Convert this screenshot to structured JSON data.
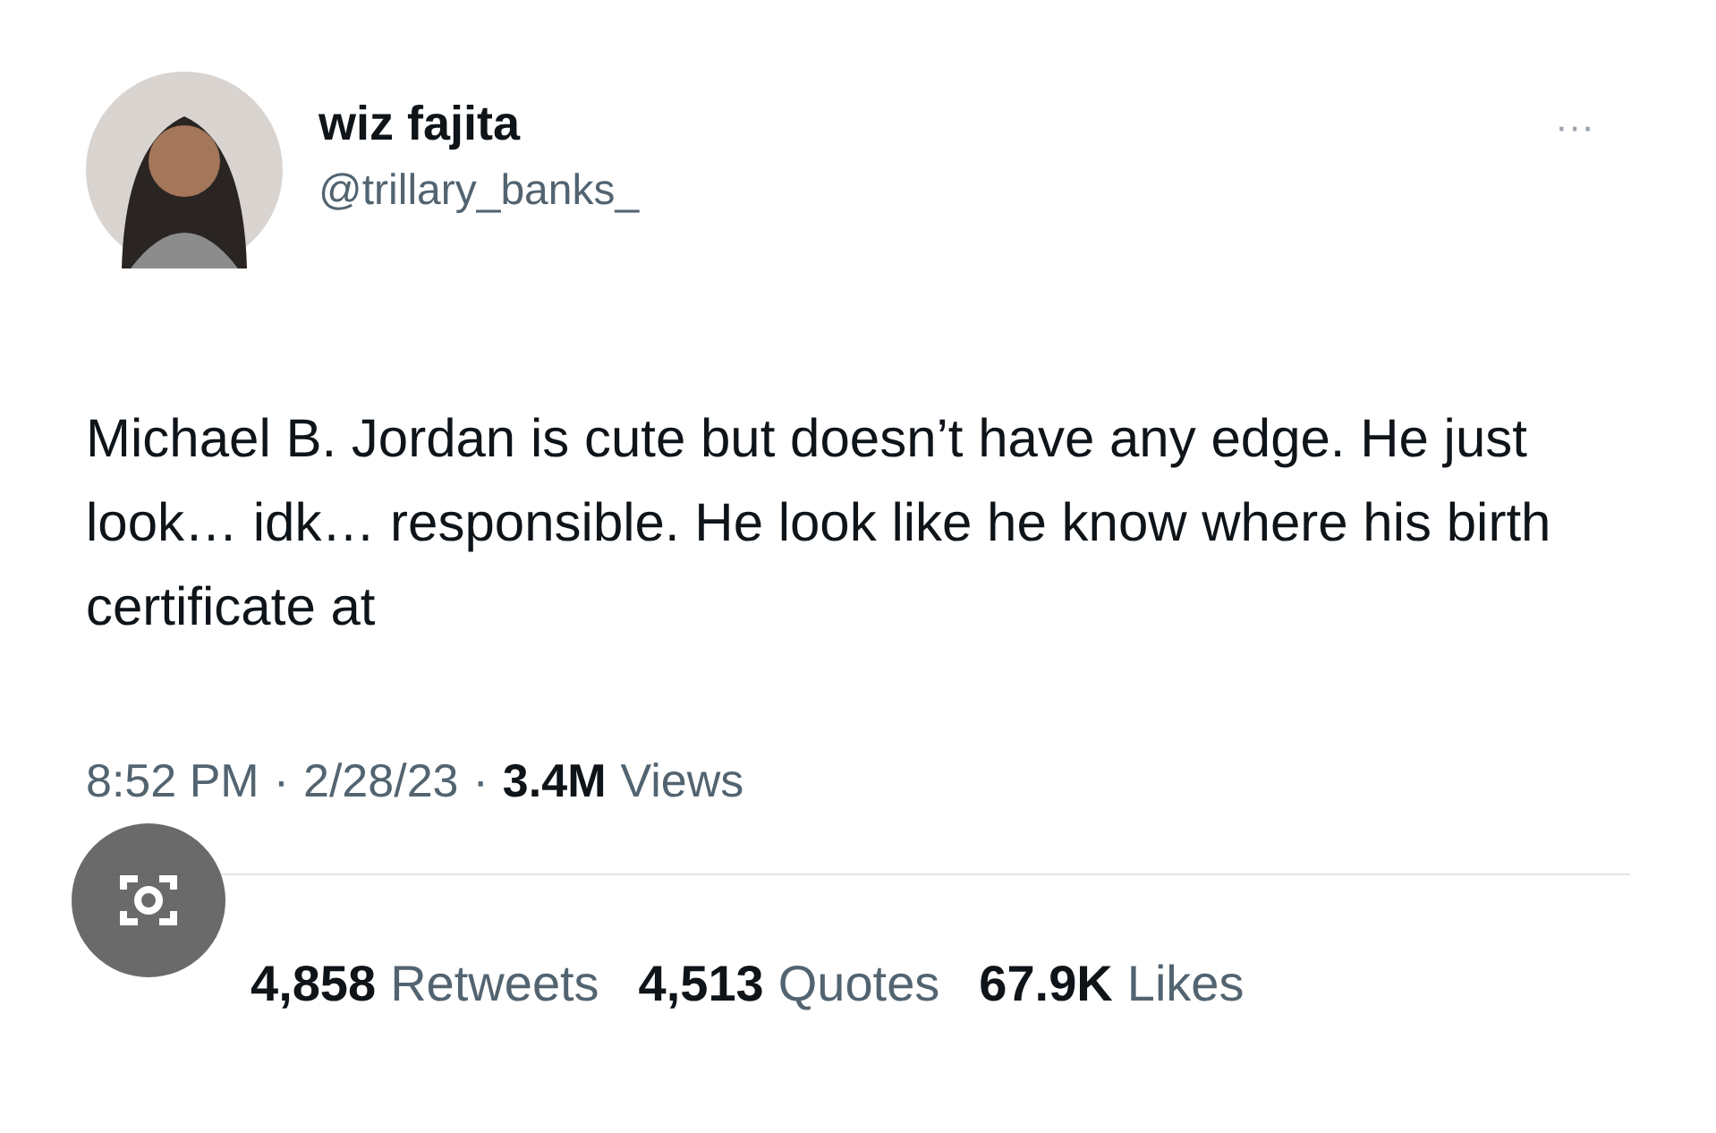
{
  "author": {
    "name": "wiz fajita",
    "handle": "@trillary_banks_"
  },
  "more_button": "···",
  "text": "Michael B. Jordan is cute but doesn’t have any edge. He just look… idk… responsible. He look like he know where his birth certificate at",
  "meta": {
    "time": "8:52 PM",
    "separator": "·",
    "date": "2/28/23",
    "views_count": "3.4M",
    "views_label": "Views"
  },
  "stats": [
    {
      "count": "4,858",
      "label": "Retweets"
    },
    {
      "count": "4,513",
      "label": "Quotes"
    },
    {
      "count": "67.9K",
      "label": "Likes"
    }
  ]
}
